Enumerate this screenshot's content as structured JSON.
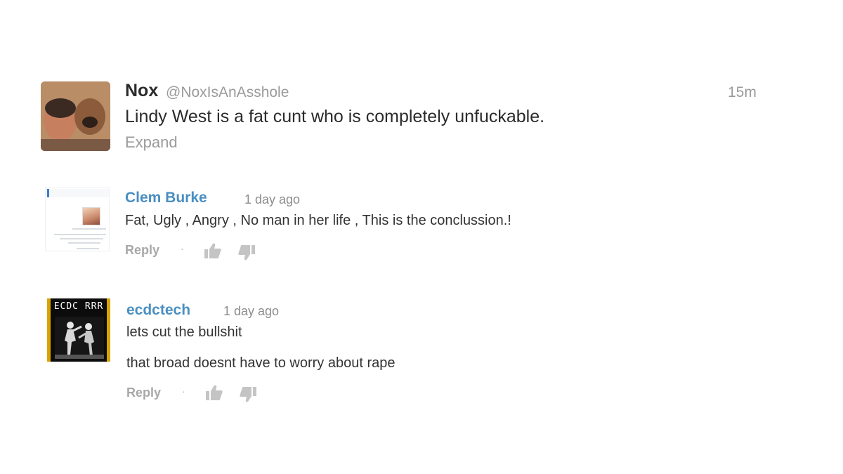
{
  "tweet": {
    "name": "Nox",
    "handle": "@NoxIsAnAsshole",
    "time": "15m",
    "text": "Lindy West is a fat cunt who is completely unfuckable.",
    "expand_label": "Expand"
  },
  "comments": [
    {
      "author": "Clem Burke",
      "time": "1 day ago",
      "lines": [
        "Fat, Ugly , Angry , No man in her life , This is the conclussion.!"
      ],
      "reply_label": "Reply",
      "separator": "·",
      "icons": {
        "like": "thumbs-up-icon",
        "dislike": "thumbs-down-icon"
      }
    },
    {
      "author": "ecdctech",
      "time": "1 day ago",
      "avatar_text": "ECDC RRR",
      "lines": [
        "lets cut the bullshit",
        "that broad doesnt have to worry about rape"
      ],
      "reply_label": "Reply",
      "separator": "·",
      "icons": {
        "like": "thumbs-up-icon",
        "dislike": "thumbs-down-icon"
      }
    }
  ],
  "colors": {
    "name_link": "#4a8fc2",
    "muted": "#9a9a9a",
    "icon_gray": "#c4c4c4",
    "avatar_gold": "#d9a400"
  }
}
